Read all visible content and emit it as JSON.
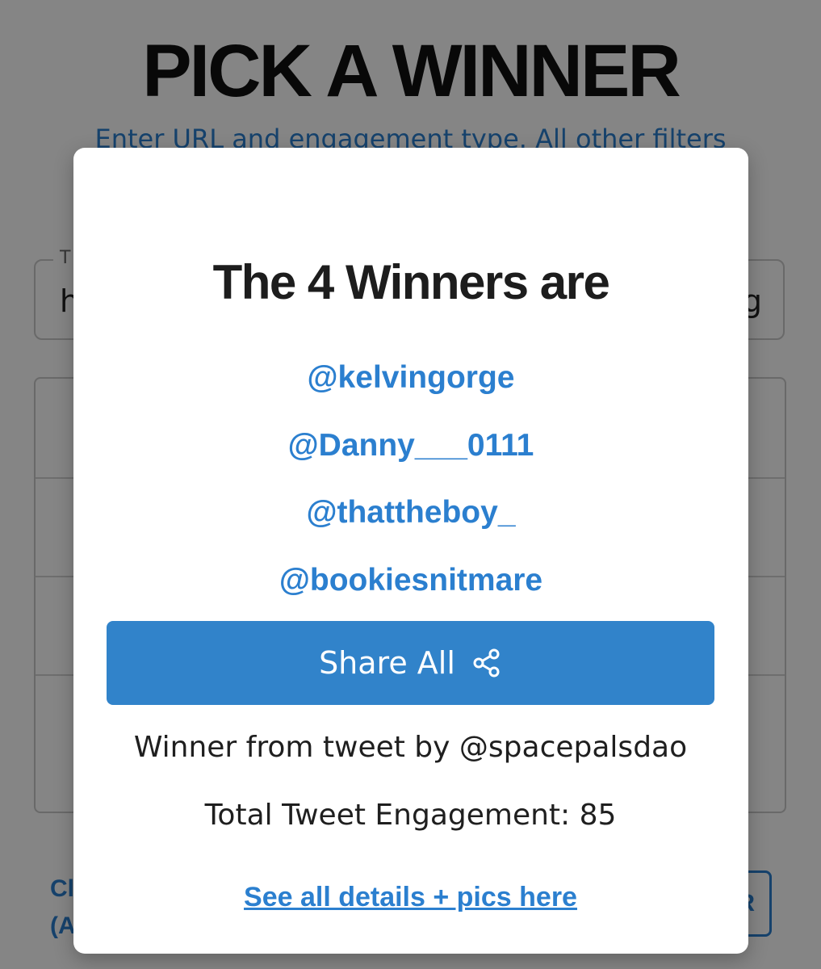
{
  "background": {
    "title": "PICK A WINNER",
    "subtitle": "Enter URL and engagement type. All other filters",
    "url_field_legend": "T",
    "url_field_value": "h",
    "url_field_value_end": "g",
    "bottom_link_text": "Cl\n(A",
    "bottom_button_label": "R"
  },
  "modal": {
    "title": "The 4 Winners are",
    "winners": [
      "@kelvingorge",
      "@Danny___0111",
      "@thattheboy_",
      "@bookiesnitmare"
    ],
    "share_button_label": "Share All",
    "share_icon": "share-icon",
    "source_text": "Winner from tweet by @spacepalsdao",
    "engagement_text": "Total Tweet Engagement: 85",
    "details_link_text": "See all details + pics here"
  },
  "colors": {
    "accent": "#2b7fcf",
    "button": "#3183ca",
    "overlay": "rgba(0,0,0,0.48)",
    "text": "#1f1f1f"
  }
}
